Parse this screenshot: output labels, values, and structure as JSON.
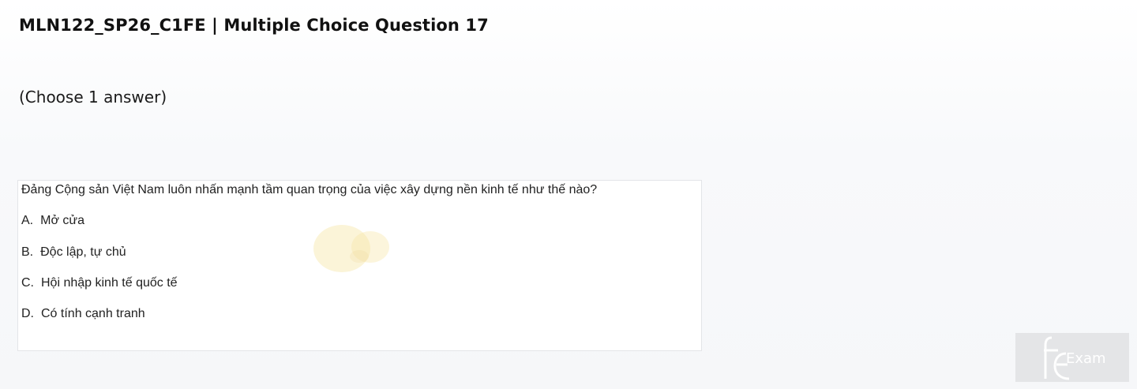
{
  "header": {
    "title": "MLN122_SP26_C1FE | Multiple Choice Question 17"
  },
  "instruction": "(Choose 1 answer)",
  "question": {
    "text": "Đảng Cộng sản Việt Nam luôn nhấn mạnh tầm quan trọng của việc xây dựng nền kinh tế như thế nào?",
    "options": [
      {
        "letter": "A.",
        "text": "Mở cửa"
      },
      {
        "letter": "B.",
        "text": "Độc lập, tự chủ"
      },
      {
        "letter": "C.",
        "text": "Hội nhập kinh tế quốc tế"
      },
      {
        "letter": "D.",
        "text": "Có tính cạnh tranh"
      }
    ]
  },
  "logo": {
    "name": "fe-exam-logo",
    "text": "Exam",
    "color": "#ffffff",
    "background": "#e4e5e7"
  },
  "watermark": {
    "icon": "faint-yellow-watermark",
    "color": "#f7e7a8"
  }
}
